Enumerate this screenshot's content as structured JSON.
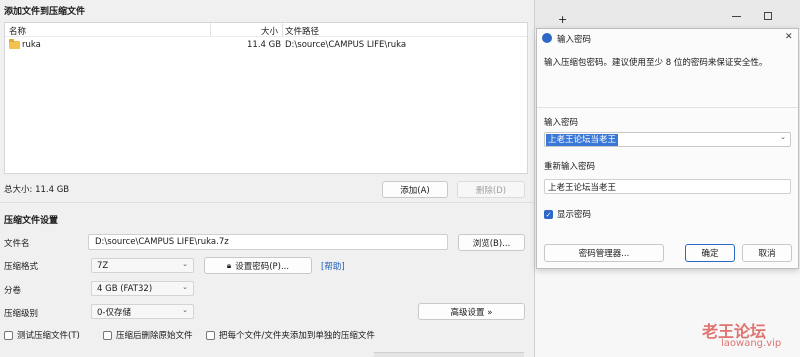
{
  "main": {
    "title": "添加文件到压缩文件",
    "file_list": {
      "columns": [
        "名称",
        "大小",
        "文件路径"
      ],
      "rows": [
        {
          "name": "ruka",
          "size": "11.4 GB",
          "path": "D:\\source\\CAMPUS LIFE\\ruka"
        }
      ]
    },
    "total_size": "总大小: 11.4 GB",
    "add_button": "添加(A)",
    "delete_button": "删除(D)",
    "settings_title": "压缩文件设置",
    "filename_label": "文件名",
    "filename_value": "D:\\source\\CAMPUS LIFE\\ruka.7z",
    "browse_button": "浏览(B)...",
    "format_label": "压缩格式",
    "format_value": "7Z",
    "set_password_button": "设置密码(P)...",
    "help_link": "[帮助]",
    "split_label": "分卷",
    "split_value": "4 GB (FAT32)",
    "level_label": "压缩级别",
    "level_value": "0-仅存储",
    "advanced_button": "高级设置 »",
    "check_test": "测试压缩文件(T)",
    "check_delete_src": "压缩后删除原始文件",
    "check_separate": "把每个文件/文件夹添加到单独的压缩文件"
  },
  "browser_bg": {
    "plus": "+",
    "watermark_cn": "老王论坛",
    "watermark_url": "laowang.vip"
  },
  "dialog": {
    "title": "输入密码",
    "description": "输入压缩包密码。建议使用至少 8 位的密码来保证安全性。",
    "password_label": "输入密码",
    "password_value": "上老王论坛当老王",
    "confirm_label": "重新输入密码",
    "confirm_value": "上老王论坛当老王",
    "show_password": "显示密码",
    "manager_button": "密码管理器...",
    "ok_button": "确定",
    "cancel_button": "取消",
    "close_glyph": "✕"
  },
  "colors": {
    "accent": "#2d67c7",
    "selection": "#3a78d8",
    "link": "#1f5fb8",
    "watermark": "#d9534f"
  }
}
